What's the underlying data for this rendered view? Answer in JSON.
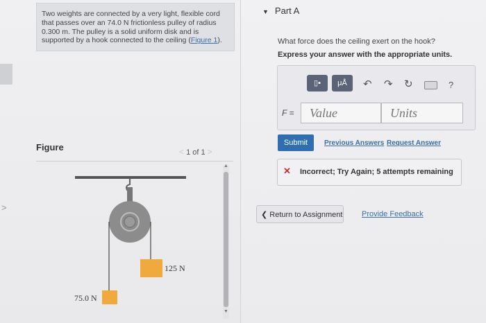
{
  "problem": {
    "text": "Two weights are connected by a very light, flexible cord that passes over an 74.0 N frictionless pulley of radius 0.300 m. The pulley is a solid uniform disk and is supported by a hook connected to the ceiling (",
    "figure_link": "Figure 1",
    "text_end": ")."
  },
  "figure": {
    "label": "Figure",
    "pager": "1 of 1",
    "weight_right": "125 N",
    "weight_left": "75.0 N"
  },
  "part": {
    "title": "Part A",
    "question": "What force does the ceiling exert on the hook?",
    "instruction": "Express your answer with the appropriate units."
  },
  "answer": {
    "tool_templates": "▯▪",
    "tool_units": "μÅ",
    "help": "?",
    "var_label": "F =",
    "value_placeholder": "Value",
    "units_placeholder": "Units"
  },
  "actions": {
    "submit": "Submit",
    "previous_answers": "Previous Answers",
    "request_answer": "Request Answer"
  },
  "feedback": {
    "message": "Incorrect; Try Again; 5 attempts remaining"
  },
  "footer": {
    "return": "Return to Assignment",
    "provide_feedback": "Provide Feedback"
  },
  "colors": {
    "accent": "#2f6eb0",
    "error": "#c0312b",
    "weight_fill": "#f0a93c",
    "toolbar": "#5b6378"
  }
}
